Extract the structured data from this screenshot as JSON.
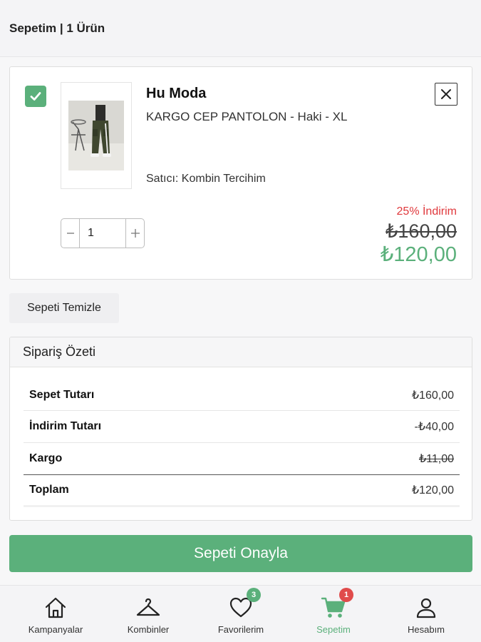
{
  "header": {
    "title": "Sepetim | 1 Ürün"
  },
  "cart_item": {
    "brand": "Hu Moda",
    "product_name": "KARGO CEP PANTOLON - Haki - XL",
    "seller": "Satıcı: Kombin Tercihim",
    "quantity": "1",
    "discount_label": "25% İndirim",
    "old_price": "₺160,00",
    "new_price": "₺120,00",
    "checked": true
  },
  "clear_cart": {
    "label": "Sepeti Temizle"
  },
  "summary": {
    "title": "Sipariş Özeti",
    "rows": [
      {
        "label": "Sepet Tutarı",
        "value": "₺160,00"
      },
      {
        "label": "İndirim Tutarı",
        "value": "-₺40,00"
      },
      {
        "label": "Kargo",
        "value": "₺11,00"
      },
      {
        "label": "Toplam",
        "value": "₺120,00"
      }
    ]
  },
  "confirm": {
    "label": "Sepeti Onayla"
  },
  "bottom_nav": {
    "items": [
      {
        "label": "Kampanyalar",
        "icon": "home-icon"
      },
      {
        "label": "Kombinler",
        "icon": "hanger-icon"
      },
      {
        "label": "Favorilerim",
        "icon": "heart-icon",
        "badge": "3"
      },
      {
        "label": "Sepetim",
        "icon": "cart-icon",
        "badge": "1",
        "active": true
      },
      {
        "label": "Hesabım",
        "icon": "user-icon"
      }
    ]
  },
  "colors": {
    "accent": "#5bb07b",
    "discount": "#e0383c",
    "badge_red": "#e04b4b",
    "badge_green": "#5bb07b"
  }
}
